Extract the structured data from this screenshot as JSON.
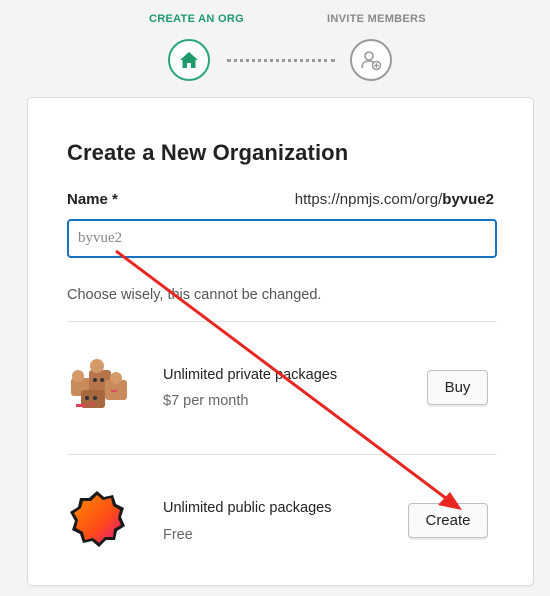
{
  "steps": [
    {
      "label": "CREATE AN ORG",
      "state": "active",
      "icon": "home-icon"
    },
    {
      "label": "INVITE MEMBERS",
      "state": "inactive",
      "icon": "add-user-icon"
    }
  ],
  "form": {
    "title": "Create a New Organization",
    "name_label": "Name *",
    "url_prefix": "https://npmjs.com/org/",
    "url_org": "byvue2",
    "name_value": "byvue2",
    "hint": "Choose wisely, this cannot be changed."
  },
  "plans": [
    {
      "title": "Unlimited private packages",
      "price": "$7 per month",
      "button": "Buy",
      "icon": "private-packages-illustration"
    },
    {
      "title": "Unlimited public packages",
      "price": "Free",
      "button": "Create",
      "icon": "public-packages-badge"
    }
  ],
  "colors": {
    "accent": "#2aa576",
    "input_border": "#1a72c4",
    "annotation_arrow": "#e8261f"
  }
}
